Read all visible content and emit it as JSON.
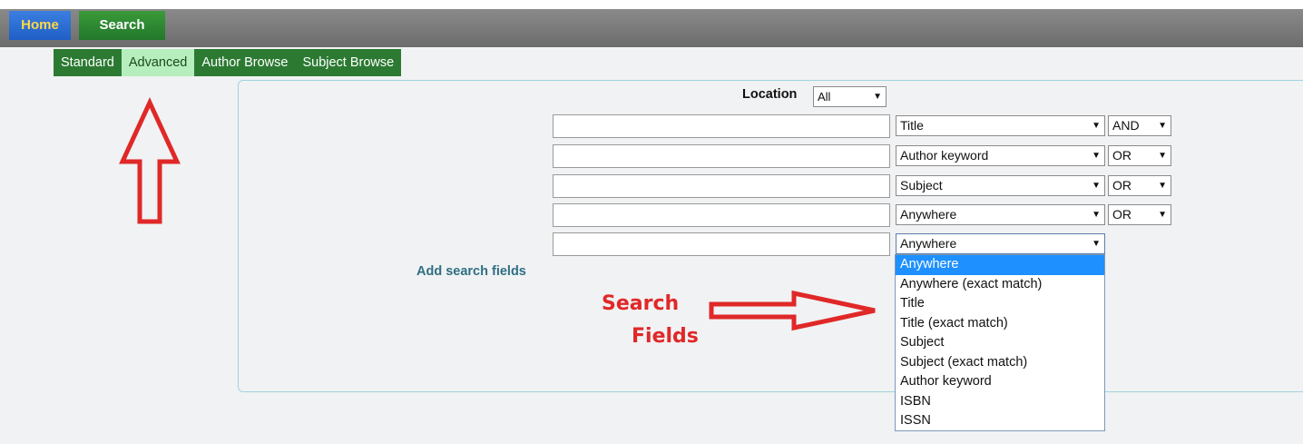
{
  "nav": {
    "home_label": "Home",
    "search_label": "Search",
    "subtabs": [
      "Standard",
      "Advanced",
      "Author Browse",
      "Subject Browse"
    ],
    "active_subtab": "Advanced"
  },
  "form": {
    "location_label": "Location",
    "location_value": "All",
    "rows": [
      {
        "field": "Title",
        "bool": "AND"
      },
      {
        "field": "Author keyword",
        "bool": "OR"
      },
      {
        "field": "Subject",
        "bool": "OR"
      },
      {
        "field": "Anywhere",
        "bool": "OR"
      },
      {
        "field": "Anywhere"
      }
    ],
    "add_fields_label": "Add search fields",
    "field_options": [
      "Anywhere",
      "Anywhere (exact match)",
      "Title",
      "Title (exact match)",
      "Subject",
      "Subject (exact match)",
      "Author keyword",
      "ISBN",
      "ISSN"
    ],
    "highlighted_option": "Anywhere"
  },
  "annotations": {
    "search_fields_line1": "Search",
    "search_fields_line2": "Fields",
    "arrow_color": "#e02828"
  },
  "colors": {
    "home_tab": "#1f5fc6",
    "home_text": "#ffd84a",
    "search_tab": "#22782a",
    "subnav": "#2c7a32",
    "active_subtab": "#b7eebd",
    "panel_border": "#9ed3df",
    "link": "#2f6f84",
    "highlight": "#1e90ff"
  }
}
